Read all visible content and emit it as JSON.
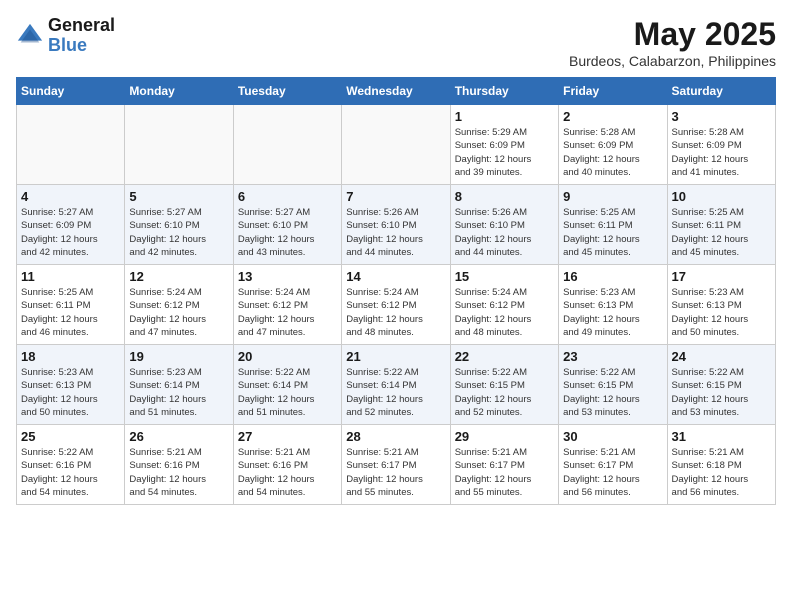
{
  "header": {
    "logo_line1": "General",
    "logo_line2": "Blue",
    "month_year": "May 2025",
    "location": "Burdeos, Calabarzon, Philippines"
  },
  "days_of_week": [
    "Sunday",
    "Monday",
    "Tuesday",
    "Wednesday",
    "Thursday",
    "Friday",
    "Saturday"
  ],
  "weeks": [
    [
      {
        "day": "",
        "info": ""
      },
      {
        "day": "",
        "info": ""
      },
      {
        "day": "",
        "info": ""
      },
      {
        "day": "",
        "info": ""
      },
      {
        "day": "1",
        "info": "Sunrise: 5:29 AM\nSunset: 6:09 PM\nDaylight: 12 hours\nand 39 minutes."
      },
      {
        "day": "2",
        "info": "Sunrise: 5:28 AM\nSunset: 6:09 PM\nDaylight: 12 hours\nand 40 minutes."
      },
      {
        "day": "3",
        "info": "Sunrise: 5:28 AM\nSunset: 6:09 PM\nDaylight: 12 hours\nand 41 minutes."
      }
    ],
    [
      {
        "day": "4",
        "info": "Sunrise: 5:27 AM\nSunset: 6:09 PM\nDaylight: 12 hours\nand 42 minutes."
      },
      {
        "day": "5",
        "info": "Sunrise: 5:27 AM\nSunset: 6:10 PM\nDaylight: 12 hours\nand 42 minutes."
      },
      {
        "day": "6",
        "info": "Sunrise: 5:27 AM\nSunset: 6:10 PM\nDaylight: 12 hours\nand 43 minutes."
      },
      {
        "day": "7",
        "info": "Sunrise: 5:26 AM\nSunset: 6:10 PM\nDaylight: 12 hours\nand 44 minutes."
      },
      {
        "day": "8",
        "info": "Sunrise: 5:26 AM\nSunset: 6:10 PM\nDaylight: 12 hours\nand 44 minutes."
      },
      {
        "day": "9",
        "info": "Sunrise: 5:25 AM\nSunset: 6:11 PM\nDaylight: 12 hours\nand 45 minutes."
      },
      {
        "day": "10",
        "info": "Sunrise: 5:25 AM\nSunset: 6:11 PM\nDaylight: 12 hours\nand 45 minutes."
      }
    ],
    [
      {
        "day": "11",
        "info": "Sunrise: 5:25 AM\nSunset: 6:11 PM\nDaylight: 12 hours\nand 46 minutes."
      },
      {
        "day": "12",
        "info": "Sunrise: 5:24 AM\nSunset: 6:12 PM\nDaylight: 12 hours\nand 47 minutes."
      },
      {
        "day": "13",
        "info": "Sunrise: 5:24 AM\nSunset: 6:12 PM\nDaylight: 12 hours\nand 47 minutes."
      },
      {
        "day": "14",
        "info": "Sunrise: 5:24 AM\nSunset: 6:12 PM\nDaylight: 12 hours\nand 48 minutes."
      },
      {
        "day": "15",
        "info": "Sunrise: 5:24 AM\nSunset: 6:12 PM\nDaylight: 12 hours\nand 48 minutes."
      },
      {
        "day": "16",
        "info": "Sunrise: 5:23 AM\nSunset: 6:13 PM\nDaylight: 12 hours\nand 49 minutes."
      },
      {
        "day": "17",
        "info": "Sunrise: 5:23 AM\nSunset: 6:13 PM\nDaylight: 12 hours\nand 50 minutes."
      }
    ],
    [
      {
        "day": "18",
        "info": "Sunrise: 5:23 AM\nSunset: 6:13 PM\nDaylight: 12 hours\nand 50 minutes."
      },
      {
        "day": "19",
        "info": "Sunrise: 5:23 AM\nSunset: 6:14 PM\nDaylight: 12 hours\nand 51 minutes."
      },
      {
        "day": "20",
        "info": "Sunrise: 5:22 AM\nSunset: 6:14 PM\nDaylight: 12 hours\nand 51 minutes."
      },
      {
        "day": "21",
        "info": "Sunrise: 5:22 AM\nSunset: 6:14 PM\nDaylight: 12 hours\nand 52 minutes."
      },
      {
        "day": "22",
        "info": "Sunrise: 5:22 AM\nSunset: 6:15 PM\nDaylight: 12 hours\nand 52 minutes."
      },
      {
        "day": "23",
        "info": "Sunrise: 5:22 AM\nSunset: 6:15 PM\nDaylight: 12 hours\nand 53 minutes."
      },
      {
        "day": "24",
        "info": "Sunrise: 5:22 AM\nSunset: 6:15 PM\nDaylight: 12 hours\nand 53 minutes."
      }
    ],
    [
      {
        "day": "25",
        "info": "Sunrise: 5:22 AM\nSunset: 6:16 PM\nDaylight: 12 hours\nand 54 minutes."
      },
      {
        "day": "26",
        "info": "Sunrise: 5:21 AM\nSunset: 6:16 PM\nDaylight: 12 hours\nand 54 minutes."
      },
      {
        "day": "27",
        "info": "Sunrise: 5:21 AM\nSunset: 6:16 PM\nDaylight: 12 hours\nand 54 minutes."
      },
      {
        "day": "28",
        "info": "Sunrise: 5:21 AM\nSunset: 6:17 PM\nDaylight: 12 hours\nand 55 minutes."
      },
      {
        "day": "29",
        "info": "Sunrise: 5:21 AM\nSunset: 6:17 PM\nDaylight: 12 hours\nand 55 minutes."
      },
      {
        "day": "30",
        "info": "Sunrise: 5:21 AM\nSunset: 6:17 PM\nDaylight: 12 hours\nand 56 minutes."
      },
      {
        "day": "31",
        "info": "Sunrise: 5:21 AM\nSunset: 6:18 PM\nDaylight: 12 hours\nand 56 minutes."
      }
    ]
  ]
}
